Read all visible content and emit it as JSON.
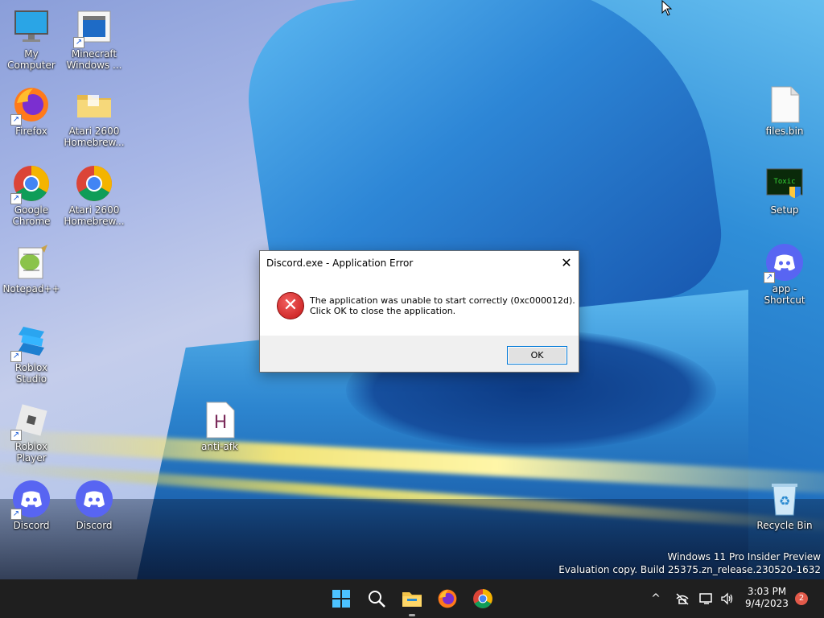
{
  "desktop": {
    "icons_left": [
      {
        "label": "My Computer",
        "icon": "monitor-icon"
      },
      {
        "label": "Minecraft Windows ...",
        "icon": "minecraft-icon"
      },
      {
        "label": "Firefox",
        "icon": "firefox-icon"
      },
      {
        "label": "Atari 2600 Homebrew...",
        "icon": "folder-icon"
      },
      {
        "label": "Google Chrome",
        "icon": "chrome-icon"
      },
      {
        "label": "Atari 2600 Homebrew...",
        "icon": "chrome-icon"
      },
      {
        "label": "Notepad++",
        "icon": "notepadpp-icon"
      },
      {
        "label": "Roblox Studio",
        "icon": "roblox-studio-icon"
      },
      {
        "label": "Roblox Player",
        "icon": "roblox-player-icon"
      },
      {
        "label": "anti-afk",
        "icon": "h-file-icon"
      },
      {
        "label": "Discord",
        "icon": "discord-icon"
      },
      {
        "label": "Discord",
        "icon": "discord-icon"
      }
    ],
    "icons_right": [
      {
        "label": "files.bin",
        "icon": "file-icon"
      },
      {
        "label": "Setup",
        "icon": "setup-icon",
        "badge_text": "Toxic"
      },
      {
        "label": "app - Shortcut",
        "icon": "discord-icon"
      },
      {
        "label": "Recycle Bin",
        "icon": "recycle-bin-icon"
      }
    ]
  },
  "dialog": {
    "title": "Discord.exe - Application Error",
    "message_line1": "The application was unable to start correctly (0xc000012d).",
    "message_line2": "Click OK to close the application.",
    "ok_label": "OK",
    "close_glyph": "✕"
  },
  "watermark": {
    "line1": "Windows 11 Pro Insider Preview",
    "line2": "Evaluation copy. Build 25375.zn_release.230520-1632"
  },
  "taskbar": {
    "pinned": [
      "start-button",
      "search-button",
      "file-explorer",
      "firefox",
      "chrome"
    ],
    "chevron_glyph": "^",
    "clock_time": "3:03 PM",
    "clock_date": "9/4/2023",
    "notification_count": "2"
  }
}
